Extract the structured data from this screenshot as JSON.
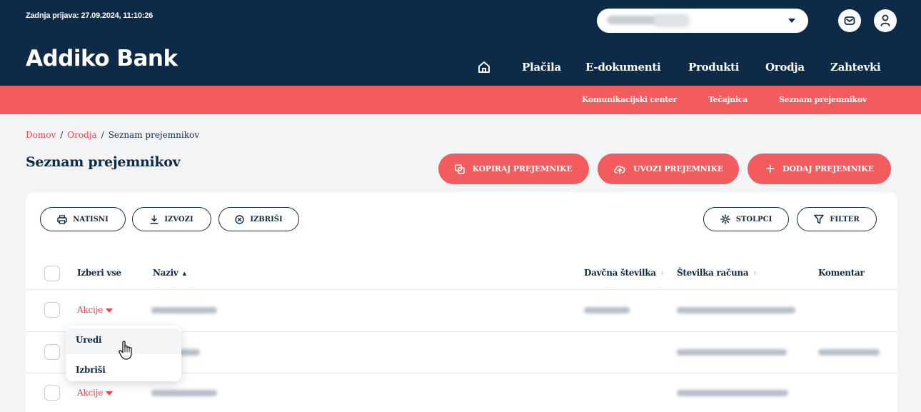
{
  "header": {
    "last_login": "Zadnja prijava: 27.09.2024, 11:10:26",
    "logo": "Addiko Bank",
    "nav": [
      "Plačila",
      "E-dokumenti",
      "Produkti",
      "Orodja",
      "Zahtevki"
    ],
    "icons": [
      "home-icon",
      "mail-icon",
      "user-icon",
      "caret-down-icon"
    ]
  },
  "subnav": [
    "Komunikacijski center",
    "Tečajnica",
    "Seznam prejemnikov"
  ],
  "breadcrumb": {
    "home": "Domov",
    "parent": "Orodja",
    "current": "Seznam prejemnikov",
    "separator": "/"
  },
  "page": {
    "title": "Seznam prejemnikov"
  },
  "actions": {
    "copy": "KOPIRAJ PREJEMNIKE",
    "import": "UVOZI PREJEMNIKE",
    "add": "DODAJ PREJEMNIKE"
  },
  "toolbar": {
    "print": "NATISNI",
    "export": "IZVOZI",
    "delete": "IZBRIŠI",
    "columns": "STOLPCI",
    "filter": "FILTER"
  },
  "table": {
    "select_all": "Izberi vse",
    "columns": [
      "Naziv",
      "Davčna številka",
      "Številka računa",
      "Komentar"
    ],
    "row_action_label": "Akcije"
  },
  "dropdown": {
    "items": [
      "Uredi",
      "Izbriši"
    ]
  },
  "colors": {
    "navy": "#0d2a47",
    "coral": "#f25c5f",
    "link_red": "#e8444a"
  }
}
